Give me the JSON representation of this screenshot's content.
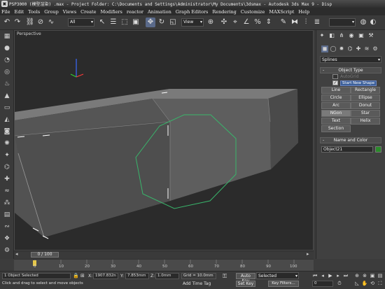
{
  "title_bar": {
    "text": "PSP3000 (模型渲染) .max - Project Folder: C:\\Documents and Settings\\Administrator\\My Documents\\3dsmax - Autodesk 3ds Max 9 - Disp"
  },
  "menu": [
    "File",
    "Edit",
    "Tools",
    "Group",
    "Views",
    "Create",
    "Modifiers",
    "reactor",
    "Animation",
    "Graph Editors",
    "Rendering",
    "Customize",
    "MAXScript",
    "Help"
  ],
  "toolbar": {
    "selection_filter": "All",
    "reference_coord": "View",
    "named_selection": ""
  },
  "viewport": {
    "label": "Perspective"
  },
  "command_panel": {
    "category_dropdown": "Splines",
    "object_type_header": "Object Type",
    "autogrid_label": "AutoGrid",
    "start_new_shape_label": "Start New Shape",
    "buttons": [
      "Line",
      "Rectangle",
      "Circle",
      "Ellipse",
      "Arc",
      "Donut",
      "NGon",
      "Star",
      "Text",
      "Helix",
      "Section"
    ],
    "name_color_header": "Name and Color",
    "object_name": "Object21",
    "object_color": "#2a8a2a"
  },
  "timeline": {
    "slider_text": "0 / 100",
    "ticks": [
      "0",
      "10",
      "20",
      "30",
      "40",
      "50",
      "60",
      "70",
      "80",
      "90",
      "100"
    ]
  },
  "status": {
    "selection_count": "1 Object Selected",
    "prompt": "Click and drag to select and move objects",
    "x_label": "X:",
    "x_value": "1907.832n",
    "y_label": "Y:",
    "y_value": "7.853mm",
    "z_label": "Z:",
    "z_value": "1.0mm",
    "grid": "Grid = 10.0mm",
    "auto_key": "Auto Key",
    "set_key": "Set Key",
    "key_mode": "Selected",
    "key_filters": "Key Filters...",
    "add_time_tag": "Add Time Tag",
    "frame": "0"
  }
}
